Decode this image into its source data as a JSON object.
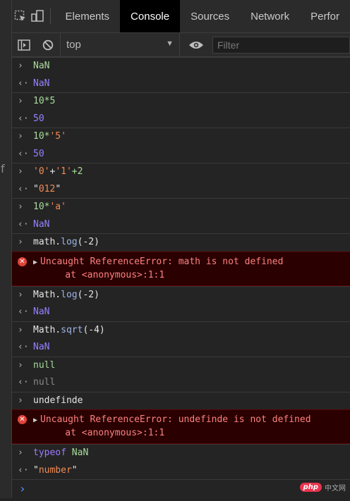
{
  "tabs": [
    "Elements",
    "Console",
    "Sources",
    "Network",
    "Perfor"
  ],
  "active_tab": "Console",
  "toolbar": {
    "context": "top",
    "filter_placeholder": "Filter"
  },
  "left_edge_glyph": "f",
  "entries": [
    {
      "kind": "input",
      "parts": [
        {
          "t": "NaN",
          "c": "green"
        }
      ]
    },
    {
      "kind": "output",
      "parts": [
        {
          "t": "NaN",
          "c": "purple"
        }
      ]
    },
    {
      "kind": "input",
      "parts": [
        {
          "t": "10*5",
          "c": "green"
        }
      ]
    },
    {
      "kind": "output",
      "parts": [
        {
          "t": "50",
          "c": "purple"
        }
      ]
    },
    {
      "kind": "input",
      "parts": [
        {
          "t": "10*",
          "c": "green"
        },
        {
          "t": "'5'",
          "c": "string"
        }
      ]
    },
    {
      "kind": "output",
      "parts": [
        {
          "t": "50",
          "c": "purple"
        }
      ]
    },
    {
      "kind": "input",
      "parts": [
        {
          "t": "'0'",
          "c": "string"
        },
        {
          "t": "+",
          "c": "white"
        },
        {
          "t": "'1'",
          "c": "string"
        },
        {
          "t": "+2",
          "c": "green"
        }
      ]
    },
    {
      "kind": "output",
      "parts": [
        {
          "t": "\"",
          "c": "white"
        },
        {
          "t": "012",
          "c": "red"
        },
        {
          "t": "\"",
          "c": "white"
        }
      ]
    },
    {
      "kind": "input",
      "parts": [
        {
          "t": "10*",
          "c": "green"
        },
        {
          "t": "'a'",
          "c": "string"
        }
      ]
    },
    {
      "kind": "output",
      "parts": [
        {
          "t": "NaN",
          "c": "purple"
        }
      ]
    },
    {
      "kind": "input",
      "parts": [
        {
          "t": "math.",
          "c": "white"
        },
        {
          "t": "log",
          "c": "blue"
        },
        {
          "t": "(-2)",
          "c": "white"
        }
      ]
    },
    {
      "kind": "error",
      "line1": "Uncaught ReferenceError: math is not defined",
      "line2": "    at <anonymous>:1:1"
    },
    {
      "kind": "input",
      "parts": [
        {
          "t": "Math.",
          "c": "white"
        },
        {
          "t": "log",
          "c": "blue"
        },
        {
          "t": "(-2)",
          "c": "white"
        }
      ]
    },
    {
      "kind": "output",
      "parts": [
        {
          "t": "NaN",
          "c": "purple"
        }
      ]
    },
    {
      "kind": "input",
      "parts": [
        {
          "t": "Math.",
          "c": "white"
        },
        {
          "t": "sqrt",
          "c": "blue"
        },
        {
          "t": "(-4)",
          "c": "white"
        }
      ]
    },
    {
      "kind": "output",
      "parts": [
        {
          "t": "NaN",
          "c": "purple"
        }
      ]
    },
    {
      "kind": "input",
      "parts": [
        {
          "t": "null",
          "c": "green"
        }
      ]
    },
    {
      "kind": "output",
      "parts": [
        {
          "t": "null",
          "c": "gray"
        }
      ]
    },
    {
      "kind": "input",
      "parts": [
        {
          "t": "undefinde",
          "c": "white"
        }
      ]
    },
    {
      "kind": "error",
      "line1": "Uncaught ReferenceError: undefinde is not defined",
      "line2": "    at <anonymous>:1:1"
    },
    {
      "kind": "input",
      "parts": [
        {
          "t": "typeof ",
          "c": "violet"
        },
        {
          "t": "NaN",
          "c": "green"
        }
      ]
    },
    {
      "kind": "output",
      "parts": [
        {
          "t": "\"",
          "c": "white"
        },
        {
          "t": "number",
          "c": "red"
        },
        {
          "t": "\"",
          "c": "white"
        }
      ]
    }
  ],
  "prompt_glyph": "›",
  "watermark": {
    "logo": "php",
    "text": "中文网"
  },
  "colors": {
    "green": "#a8dc9c",
    "purple": "#9580ff",
    "error_bg": "#2a0000",
    "error_text": "#ff8080",
    "prompt": "#4a9eff"
  }
}
